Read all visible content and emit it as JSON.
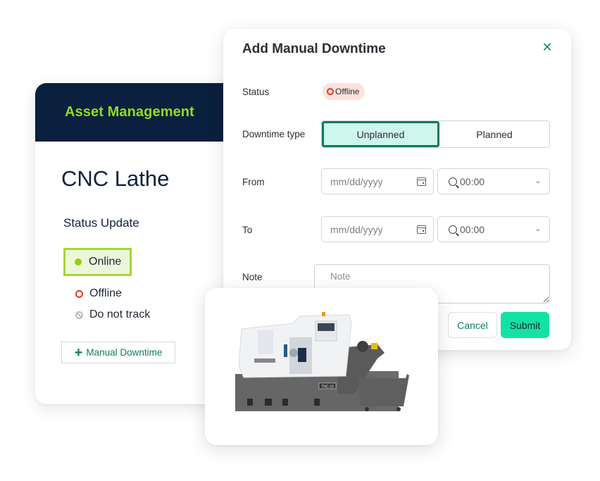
{
  "asset_card": {
    "header_title": "Asset Management",
    "asset_name": "CNC Lathe",
    "status_heading": "Status Update",
    "status_options": [
      {
        "label": "Online",
        "icon": "green-dot-icon",
        "selected": true
      },
      {
        "label": "Offline",
        "icon": "red-ring-icon",
        "selected": false
      },
      {
        "label": "Do not track",
        "icon": "ban-icon",
        "selected": false
      }
    ],
    "manual_downtime_button": "Manual Downtime"
  },
  "modal": {
    "title": "Add Manual Downtime",
    "close_icon": "close-icon",
    "status_label": "Status",
    "status_value": "Offline",
    "downtime_type_label": "Downtime type",
    "downtime_types": [
      {
        "label": "Unplanned",
        "active": true
      },
      {
        "label": "Planned",
        "active": false
      }
    ],
    "from_label": "From",
    "from_date_placeholder": "mm/dd/yyyy",
    "from_time": "00:00",
    "to_label": "To",
    "to_date_placeholder": "mm/dd/yyyy",
    "to_time": "00:00",
    "note_label": "Note",
    "note_placeholder": "Note",
    "cancel_button": "Cancel",
    "submit_button": "Submit"
  },
  "machine_card": {
    "image_label": "CNC lathe machine",
    "plate_text": "TNC-10"
  },
  "colors": {
    "header_bg": "#0b1f3f",
    "header_text": "#8fdc1e",
    "online_dot": "#8fd10b",
    "offline_ring": "#e23a1f",
    "accent_teal": "#0e7a60",
    "submit_bg": "#14e2a4",
    "unplanned_bg": "#cdf7ea"
  }
}
